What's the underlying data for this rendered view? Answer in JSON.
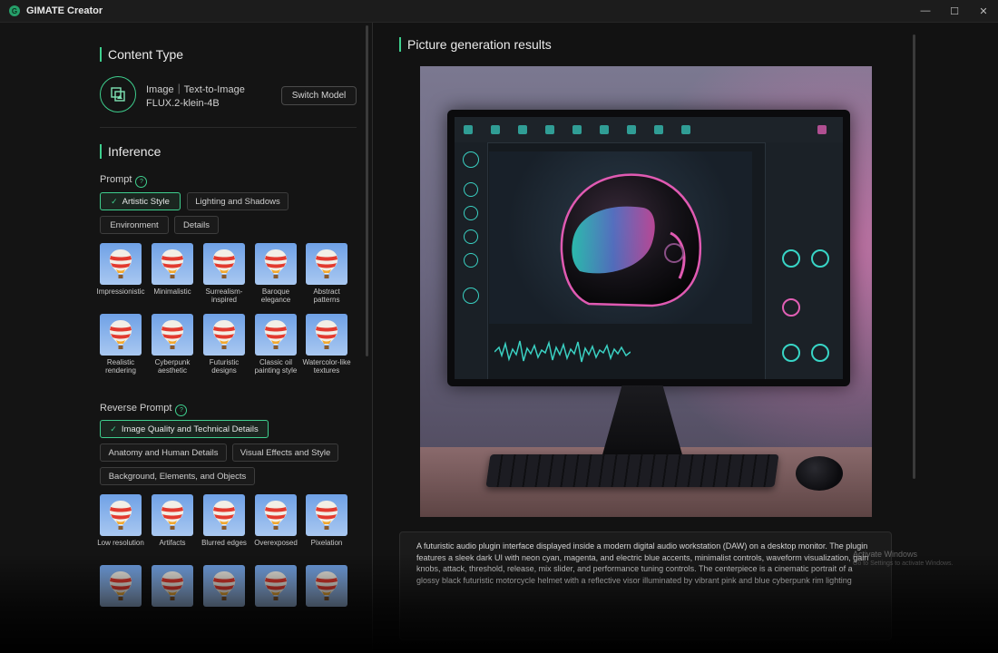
{
  "window": {
    "title": "GIMATE Creator",
    "controls": {
      "minimize": "—",
      "maximize": "☐",
      "close": "✕"
    }
  },
  "content_type": {
    "section_title": "Content Type",
    "model_icon": "image-model-icon",
    "model_kind": "Image｜Text-to-Image",
    "model_name": "FLUX.2-klein-4B",
    "switch_label": "Switch Model"
  },
  "inference": {
    "section_title": "Inference",
    "prompt": {
      "label": "Prompt",
      "chips": [
        {
          "label": "Artistic Style",
          "selected": true
        },
        {
          "label": "Lighting and Shadows",
          "selected": false
        },
        {
          "label": "Environment",
          "selected": false
        },
        {
          "label": "Details",
          "selected": false
        }
      ],
      "styles": [
        "Impressionistic",
        "Minimalistic",
        "Surrealism-inspired",
        "Baroque elegance",
        "Abstract patterns",
        "Realistic rendering",
        "Cyberpunk aesthetic",
        "Futuristic designs",
        "Classic oil painting style",
        "Watercolor-like textures"
      ]
    },
    "reverse_prompt": {
      "label": "Reverse Prompt",
      "chips": [
        {
          "label": "Image Quality and Technical Details",
          "selected": true
        },
        {
          "label": "Anatomy and Human Details",
          "selected": false
        },
        {
          "label": "Visual Effects and Style",
          "selected": false
        },
        {
          "label": "Background, Elements, and Objects",
          "selected": false
        }
      ],
      "items": [
        "Low resolution",
        "Artifacts",
        "Blurred edges",
        "Overexposed",
        "Pixelation"
      ]
    }
  },
  "results": {
    "section_title": "Picture generation results",
    "prompt_text": "A futuristic audio plugin interface displayed inside a modern digital audio workstation (DAW) on a desktop monitor. The plugin features a sleek dark UI with neon cyan, magenta, and electric blue accents, minimalist controls, waveform visualization, gain knobs, attack, threshold, release, mix slider, and performance tuning controls. The centerpiece is a cinematic portrait of a glossy black futuristic motorcycle helmet with a reflective visor illuminated by vibrant pink and blue cyberpunk rim lighting"
  },
  "os_watermark": {
    "line1": "Activate Windows",
    "line2": "Go to Settings to activate Windows."
  },
  "colors": {
    "accent": "#3ecf8e",
    "background": "#141414",
    "panel": "#1b1b1b"
  }
}
